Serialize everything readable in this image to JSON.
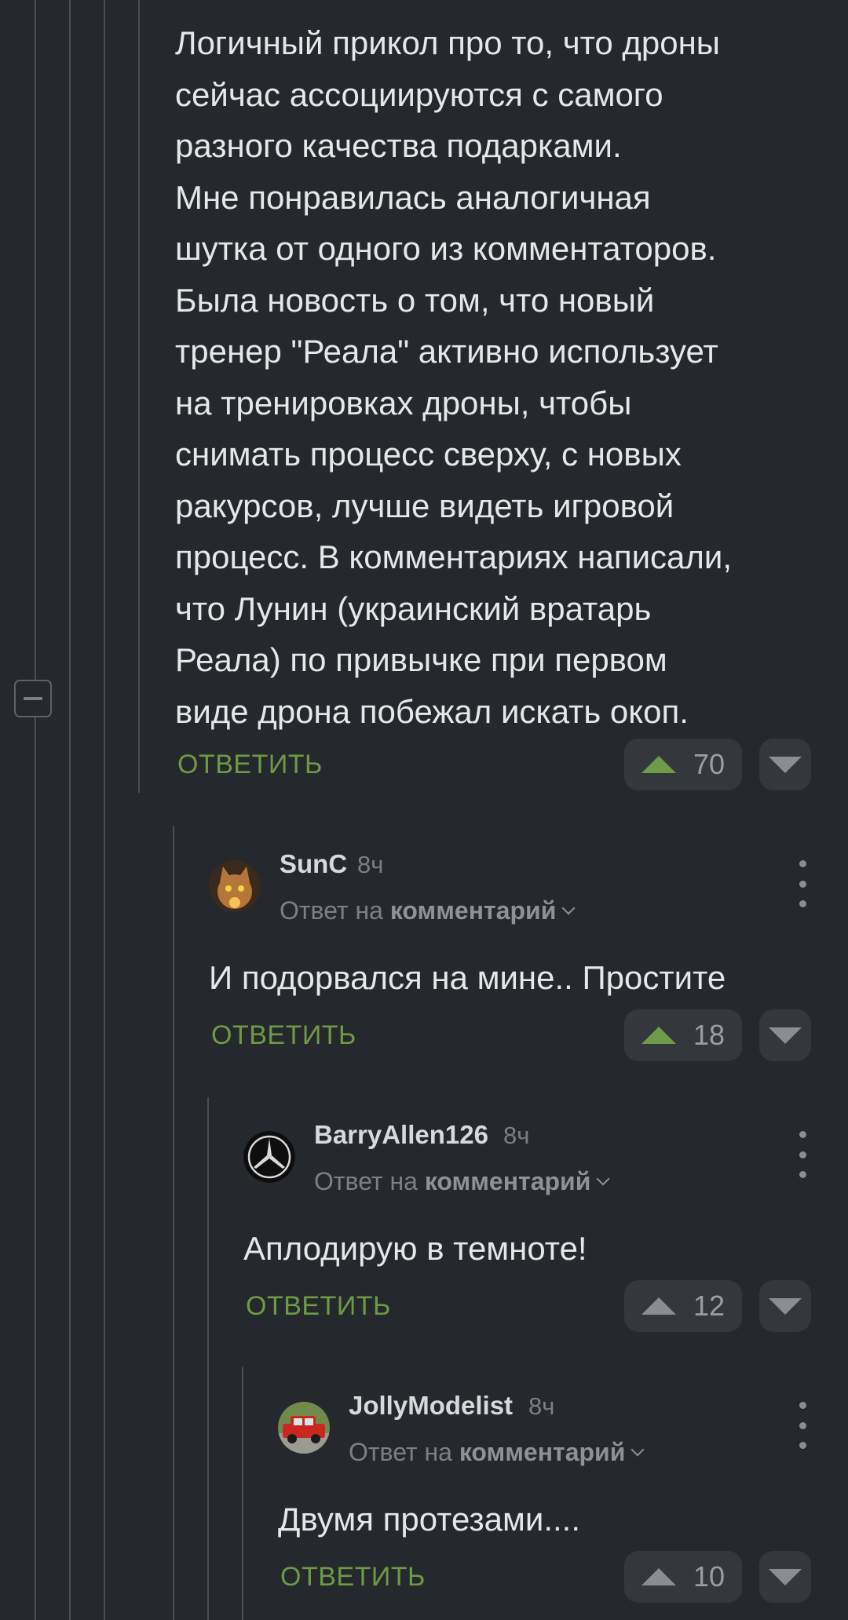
{
  "root_comment": {
    "text": "Логичный прикол про то, что дроны\nсейчас ассоциируются с самого\nразного качества подарками.\nМне понравилась аналогичная\nшутка от одного из комментаторов.\nБыла новость о том, что новый\nтренер \"Реала\" активно использует\nна тренировках дроны, чтобы\nснимать процесс сверху, с новых\nракурсов, лучше видеть игровой\nпроцесс. В комментариях написали,\nчто Лунин (украинский вратарь\nРеала) по привычке при первом\nвиде дрона побежал искать окоп.",
    "reply_label": "ОТВЕТИТЬ",
    "rating": "70",
    "upvote_icon": "arrow-up-icon",
    "downvote_icon": "arrow-down-icon"
  },
  "replies": [
    {
      "username": "SunC",
      "time": "8ч",
      "reply_prefix": "Ответ на",
      "reply_link": "комментарий",
      "text": "И подорвался на мине.. Простите",
      "reply_label": "ОТВЕТИТЬ",
      "rating": "18",
      "avatar": "cat-avatar",
      "upvote_color": "#6e9b47"
    },
    {
      "username": "BarryAllen126",
      "time": "8ч",
      "reply_prefix": "Ответ на",
      "reply_link": "комментарий",
      "text": "Аплодирую в темноте!",
      "reply_label": "ОТВЕТИТЬ",
      "rating": "12",
      "avatar": "mercedes-logo-avatar",
      "upvote_color": "#8a8d92"
    },
    {
      "username": "JollyModelist",
      "time": "8ч",
      "reply_prefix": "Ответ на",
      "reply_link": "комментарий",
      "text": "Двумя протезами....",
      "reply_label": "ОТВЕТИТЬ",
      "rating": "10",
      "avatar": "red-car-avatar",
      "upvote_color": "#8a8d92"
    }
  ],
  "colors": {
    "background": "#25282c",
    "accent_green": "#6d9a46",
    "thread_line": "#4a4d52",
    "button_bg": "#34373c"
  }
}
